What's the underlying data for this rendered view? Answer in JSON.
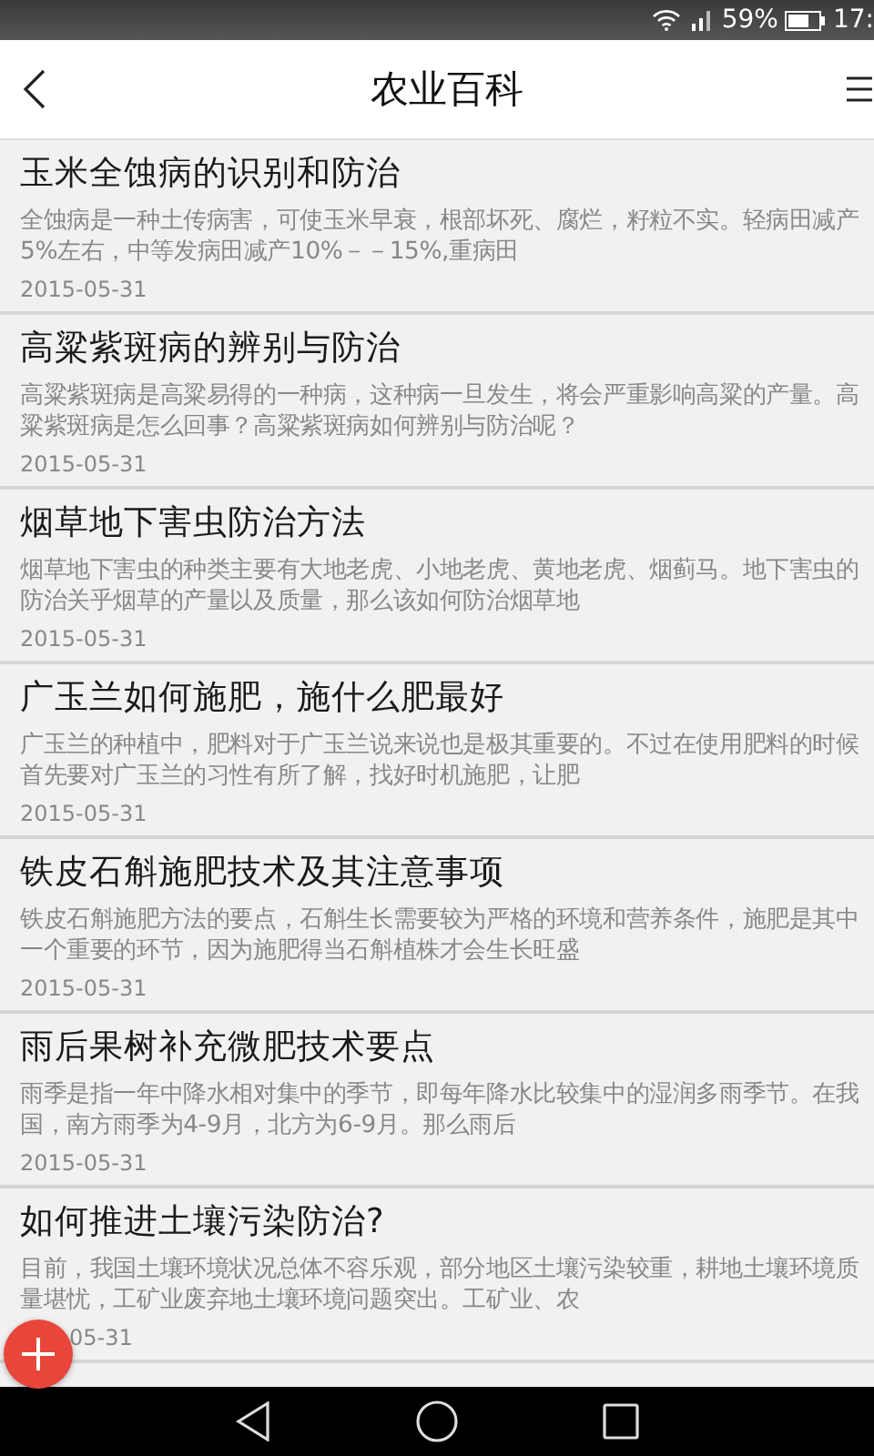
{
  "status_bar": {
    "battery": "59%",
    "time": "17:"
  },
  "header": {
    "title": "农业百科"
  },
  "articles": [
    {
      "title": "玉米全蚀病的识别和防治",
      "summary": "全蚀病是一种土传病害，可使玉米早衰，根部坏死、腐烂，籽粒不实。轻病田减产5%左右，中等发病田减产10%－－15%,重病田",
      "date": "2015-05-31"
    },
    {
      "title": "高粱紫斑病的辨别与防治",
      "summary": "高粱紫斑病是高粱易得的一种病，这种病一旦发生，将会严重影响高粱的产量。高粱紫斑病是怎么回事？高粱紫斑病如何辨别与防治呢？",
      "date": "2015-05-31"
    },
    {
      "title": "烟草地下害虫防治方法",
      "summary": "烟草地下害虫的种类主要有大地老虎、小地老虎、黄地老虎、烟蓟马。地下害虫的防治关乎烟草的产量以及质量，那么该如何防治烟草地",
      "date": "2015-05-31"
    },
    {
      "title": "广玉兰如何施肥，施什么肥最好",
      "summary": "广玉兰的种植中，肥料对于广玉兰说来说也是极其重要的。不过在使用肥料的时候首先要对广玉兰的习性有所了解，找好时机施肥，让肥",
      "date": "2015-05-31"
    },
    {
      "title": "铁皮石斛施肥技术及其注意事项",
      "summary": "铁皮石斛施肥方法的要点，石斛生长需要较为严格的环境和营养条件，施肥是其中一个重要的环节，因为施肥得当石斛植株才会生长旺盛",
      "date": "2015-05-31"
    },
    {
      "title": "雨后果树补充微肥技术要点",
      "summary": "雨季是指一年中降水相对集中的季节，即每年降水比较集中的湿润多雨季节。在我国，南方雨季为4-9月，北方为6-9月。那么雨后",
      "date": "2015-05-31"
    },
    {
      "title": "如何推进土壤污染防治?",
      "summary": "目前，我国土壤环境状况总体不容乐观，部分地区土壤污染较重，耕地土壤环境质量堪忧，工矿业废弃地土壤环境问题突出。工矿业、农",
      "date": "05-31"
    }
  ]
}
